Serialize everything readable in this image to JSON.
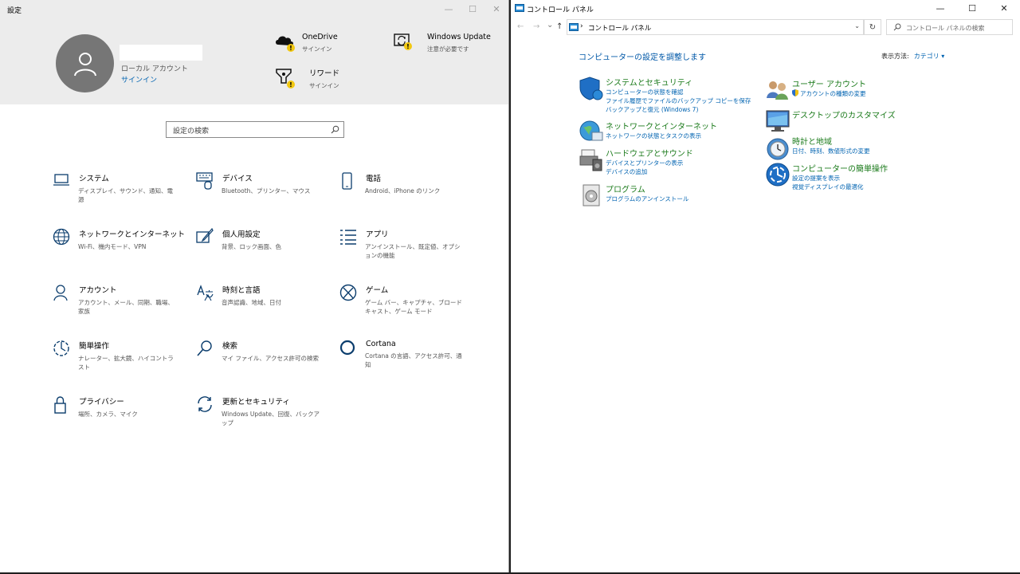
{
  "settings": {
    "title": "設定",
    "minimize": "—",
    "maximize": "☐",
    "close": "✕",
    "account": {
      "type": "ローカル アカウント",
      "signin": "サインイン"
    },
    "quick": [
      {
        "title": "OneDrive",
        "sub": "サインイン",
        "icon": "onedrive-icon"
      },
      {
        "title": "Windows Update",
        "sub": "注意が必要です",
        "icon": "windows-update-icon"
      },
      {
        "title": "リワード",
        "sub": "サインイン",
        "icon": "rewards-icon"
      }
    ],
    "search_placeholder": "設定の検索",
    "items": [
      {
        "title": "システム",
        "sub": "ディスプレイ、サウンド、通知、電源",
        "icon": "laptop-icon"
      },
      {
        "title": "デバイス",
        "sub": "Bluetooth、プリンター、マウス",
        "icon": "keyboard-icon"
      },
      {
        "title": "電話",
        "sub": "Android、iPhone のリンク",
        "icon": "phone-icon"
      },
      {
        "title": "ネットワークとインターネット",
        "sub": "Wi-Fi、機内モード、VPN",
        "icon": "globe-icon"
      },
      {
        "title": "個人用設定",
        "sub": "背景、ロック画面、色",
        "icon": "paint-icon"
      },
      {
        "title": "アプリ",
        "sub": "アンインストール、既定値、オプションの機能",
        "icon": "apps-list-icon"
      },
      {
        "title": "アカウント",
        "sub": "アカウント、メール、同期、職場、家族",
        "icon": "person-icon"
      },
      {
        "title": "時刻と言語",
        "sub": "音声認識、地域、日付",
        "icon": "time-language-icon"
      },
      {
        "title": "ゲーム",
        "sub": "ゲーム バー、キャプチャ、ブロードキャスト、ゲーム モード",
        "icon": "xbox-icon"
      },
      {
        "title": "簡単操作",
        "sub": "ナレーター、拡大鏡、ハイコントラスト",
        "icon": "ease-of-access-icon"
      },
      {
        "title": "検索",
        "sub": "マイ ファイル、アクセス許可の検索",
        "icon": "search-icon"
      },
      {
        "title": "Cortana",
        "sub": "Cortana の言語、アクセス許可、通知",
        "icon": "cortana-icon"
      },
      {
        "title": "プライバシー",
        "sub": "場所、カメラ、マイク",
        "icon": "lock-icon"
      },
      {
        "title": "更新とセキュリティ",
        "sub": "Windows Update、回復、バックアップ",
        "icon": "sync-icon"
      }
    ]
  },
  "control_panel": {
    "title": "コントロール パネル",
    "minimize": "—",
    "maximize": "☐",
    "close": "✕",
    "back": "←",
    "forward": "→",
    "recent": "⌄",
    "up": "↑",
    "address_sep": "›",
    "address": "コントロール パネル",
    "address_dropdown": "⌄",
    "refresh": "↻",
    "search_placeholder": "コントロール パネルの検索",
    "heading": "コンピューターの設定を調整します",
    "view_by_label": "表示方法:",
    "view_by_value": "カテゴリ ▾",
    "categories_left": [
      {
        "title": "システムとセキュリティ",
        "icon": "security-shield-icon",
        "links": [
          "コンピューターの状態を確認",
          "ファイル履歴でファイルのバックアップ コピーを保存",
          "バックアップと復元 (Windows 7)"
        ]
      },
      {
        "title": "ネットワークとインターネット",
        "icon": "network-globe-icon",
        "links": [
          "ネットワークの状態とタスクの表示"
        ]
      },
      {
        "title": "ハードウェアとサウンド",
        "icon": "printer-speaker-icon",
        "links": [
          "デバイスとプリンターの表示",
          "デバイスの追加"
        ]
      },
      {
        "title": "プログラム",
        "icon": "programs-icon",
        "links": [
          "プログラムのアンインストール"
        ]
      }
    ],
    "categories_right": [
      {
        "title": "ユーザー アカウント",
        "icon": "users-icon",
        "links": [
          "アカウントの種類の変更"
        ]
      },
      {
        "title": "デスクトップのカスタマイズ",
        "icon": "monitor-icon",
        "links": []
      },
      {
        "title": "時計と地域",
        "icon": "clock-globe-icon",
        "links": [
          "日付、時刻、数値形式の変更"
        ]
      },
      {
        "title": "コンピューターの簡単操作",
        "icon": "ease-access-circle-icon",
        "links": [
          "設定の提案を表示",
          "視覚ディスプレイの最適化"
        ]
      }
    ]
  }
}
